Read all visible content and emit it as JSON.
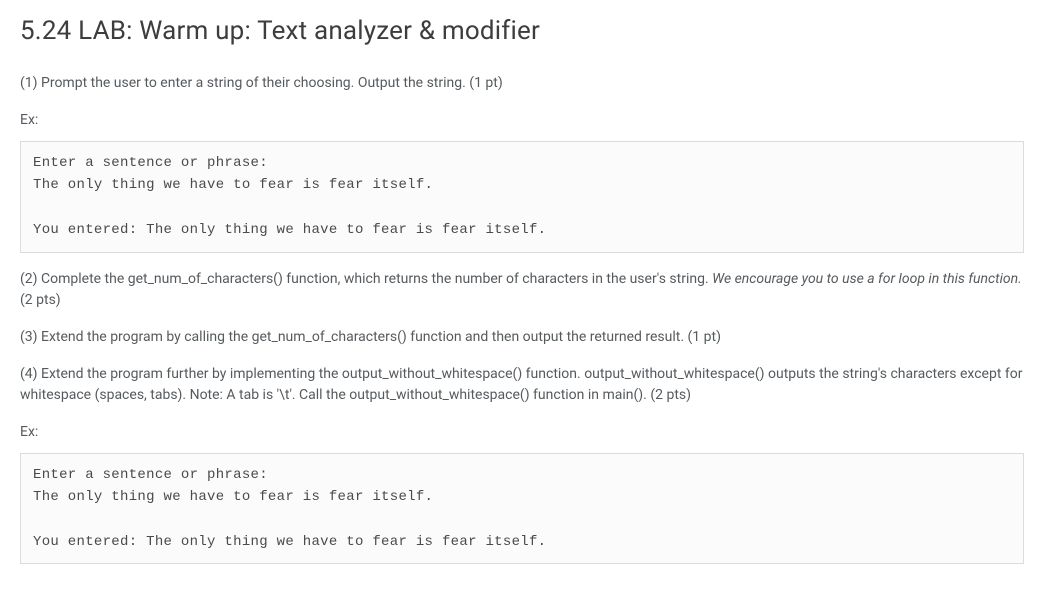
{
  "title": "5.24 LAB: Warm up: Text analyzer & modifier",
  "step1": "(1) Prompt the user to enter a string of their choosing. Output the string. (1 pt)",
  "ex_label_1": "Ex:",
  "code1": "Enter a sentence or phrase:\nThe only thing we have to fear is fear itself.\n\nYou entered: The only thing we have to fear is fear itself.",
  "step2_a": "(2) Complete the get_num_of_characters() function, which returns the number of characters in the user's string. ",
  "step2_italic": "We encourage you to use a for loop in this function.",
  "step2_b": " (2 pts)",
  "step3": "(3) Extend the program by calling the get_num_of_characters() function and then output the returned result. (1 pt)",
  "step4": "(4) Extend the program further by implementing the output_without_whitespace() function. output_without_whitespace() outputs the string's characters except for whitespace (spaces, tabs). Note: A tab is '\\t'. Call the output_without_whitespace() function in main(). (2 pts)",
  "ex_label_2": "Ex:",
  "code2": "Enter a sentence or phrase:\nThe only thing we have to fear is fear itself.\n\nYou entered: The only thing we have to fear is fear itself."
}
